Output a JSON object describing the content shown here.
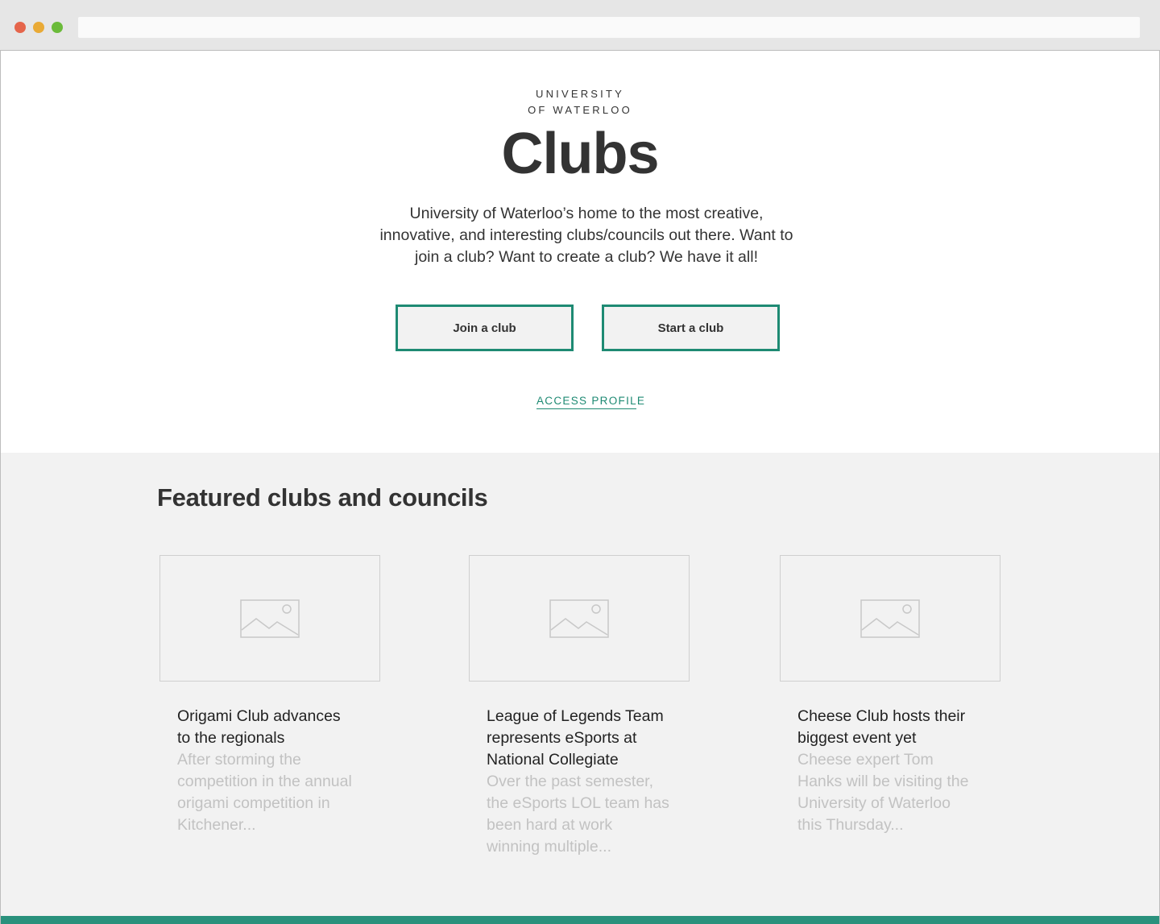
{
  "hero": {
    "wordmark_line1": "UNIVERSITY",
    "wordmark_line2": "OF WATERLOO",
    "title": "Clubs",
    "intro_line1": "University of Waterloo’s home to the most creative,",
    "intro_line2": "innovative, and interesting clubs/councils out there. Want to",
    "intro_line3": "join a club? Want to create a club? We have it all!",
    "join_button": "Join a club",
    "start_button": "Start a club",
    "access_link": "ACCESS PROFILE",
    "accent_color": "#1e8a73"
  },
  "featured": {
    "title": "Featured clubs and councils",
    "cards": [
      {
        "title_lines": [
          "Origami Club advances",
          "to the regionals"
        ],
        "excerpt_lines": [
          "After storming the",
          "competition in the annual",
          "origami competition in",
          "Kitchener..."
        ],
        "image_icon": "image-placeholder-icon"
      },
      {
        "title_lines": [
          "League of Legends Team",
          "represents eSports at",
          "National Collegiate"
        ],
        "excerpt_lines": [
          "Over the past semester,",
          "the eSports LOL team has",
          "been hard at work",
          "winning multiple..."
        ],
        "image_icon": "image-placeholder-icon"
      },
      {
        "title_lines": [
          "Cheese Club hosts their",
          "biggest event yet"
        ],
        "excerpt_lines": [
          "Cheese expert  Tom",
          "Hanks will be visiting the",
          "University of Waterloo",
          "this Thursday..."
        ],
        "image_icon": "image-placeholder-icon"
      }
    ]
  },
  "colors": {
    "window_close": "#e5654b",
    "window_minimize": "#e9aa36",
    "window_maximize": "#6bbb3a",
    "footer_bar": "#2a917c"
  }
}
